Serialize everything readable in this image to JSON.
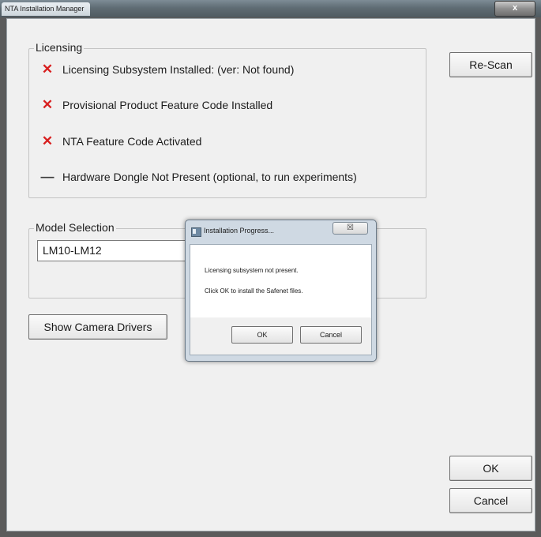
{
  "window": {
    "title": "NTA Installation Manager",
    "close_glyph": "x"
  },
  "licensing": {
    "legend": "Licensing",
    "rows": [
      {
        "mark": "✕",
        "status": "fail",
        "label": "Licensing Subsystem Installed: (ver: Not found)"
      },
      {
        "mark": "✕",
        "status": "fail",
        "label": "Provisional Product Feature Code Installed"
      },
      {
        "mark": "✕",
        "status": "fail",
        "label": "NTA Feature Code Activated"
      },
      {
        "mark": "—",
        "status": "absent",
        "label": "Hardware Dongle Not Present (optional, to run experiments)"
      }
    ]
  },
  "model": {
    "legend": "Model Selection",
    "selected": "LM10-LM12"
  },
  "buttons": {
    "rescan": "Re-Scan",
    "camera_drivers": "Show Camera Drivers",
    "ok": "OK",
    "cancel": "Cancel"
  },
  "dialog": {
    "title": "Installation Progress...",
    "close_glyph": "☒",
    "message_line1": "Licensing subsystem not present.",
    "message_line2": "Click OK to install the Safenet files.",
    "ok": "OK",
    "cancel": "Cancel"
  },
  "colors": {
    "fail_mark": "#d81e1e",
    "dialog_frame": "#cfd9e3"
  }
}
